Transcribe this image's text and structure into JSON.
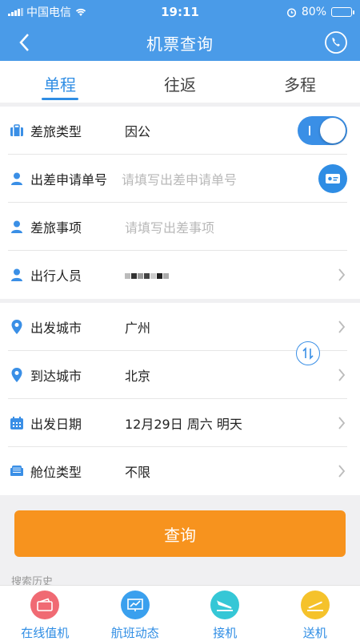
{
  "status": {
    "carrier": "中国电信",
    "time": "19:11",
    "battery": "80%",
    "battery_level": 0.8
  },
  "nav": {
    "title": "机票查询"
  },
  "tabs": [
    {
      "label": "单程",
      "active": true
    },
    {
      "label": "往返",
      "active": false
    },
    {
      "label": "多程",
      "active": false
    }
  ],
  "trip_info": {
    "travel_type": {
      "label": "差旅类型",
      "value": "因公"
    },
    "application_no": {
      "label": "出差申请单号",
      "placeholder": "请填写出差申请单号"
    },
    "travel_matter": {
      "label": "差旅事项",
      "placeholder": "请填写出差事项"
    },
    "traveler": {
      "label": "出行人员"
    }
  },
  "route": {
    "departure_city": {
      "label": "出发城市",
      "value": "广州"
    },
    "arrival_city": {
      "label": "到达城市",
      "value": "北京"
    },
    "departure_date": {
      "label": "出发日期",
      "value": "12月29日 周六 明天"
    },
    "cabin_class": {
      "label": "舱位类型",
      "value": "不限"
    }
  },
  "search_button": "查询",
  "history_label": "搜索历史",
  "bottom_nav": [
    {
      "label": "在线值机",
      "icon": "ticket-icon",
      "color": "#f06a73"
    },
    {
      "label": "航班动态",
      "icon": "chart-icon",
      "color": "#3aa0ee"
    },
    {
      "label": "接机",
      "icon": "landing-icon",
      "color": "#35c7d6"
    },
    {
      "label": "送机",
      "icon": "takeoff-icon",
      "color": "#f5c22b"
    }
  ],
  "colors": {
    "primary": "#4a9be8",
    "accent": "#2f8de4",
    "button": "#f7931e"
  }
}
